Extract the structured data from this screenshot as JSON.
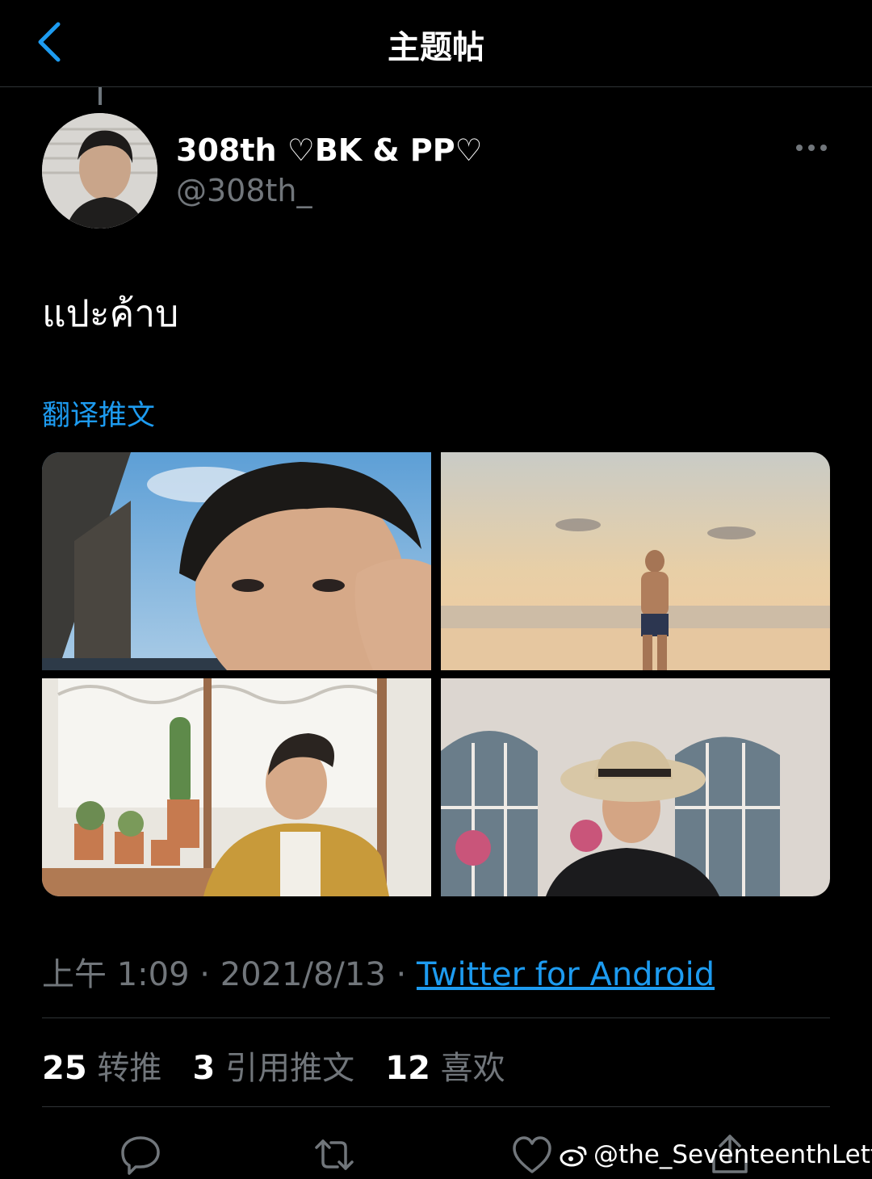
{
  "header": {
    "title": "主题帖"
  },
  "author": {
    "display_name": "308th ♡BK & PP♡",
    "handle": "@308th_"
  },
  "tweet": {
    "text": "แปะค้าบ",
    "translate_label": "翻译推文",
    "time": "上午 1:09",
    "date": "2021/8/13",
    "source": "Twitter for Android",
    "separator": " · "
  },
  "stats": {
    "retweets_count": "25",
    "retweets_label": "转推",
    "quotes_count": "3",
    "quotes_label": "引用推文",
    "likes_count": "12",
    "likes_label": "喜欢"
  },
  "actions": [
    "reply-icon",
    "retweet-icon",
    "like-icon",
    "share-icon"
  ],
  "watermark": {
    "text": "@the_SeventeenthLetter"
  },
  "colors": {
    "accent": "#1d9bf0",
    "background": "#000000",
    "muted": "#71767b"
  }
}
